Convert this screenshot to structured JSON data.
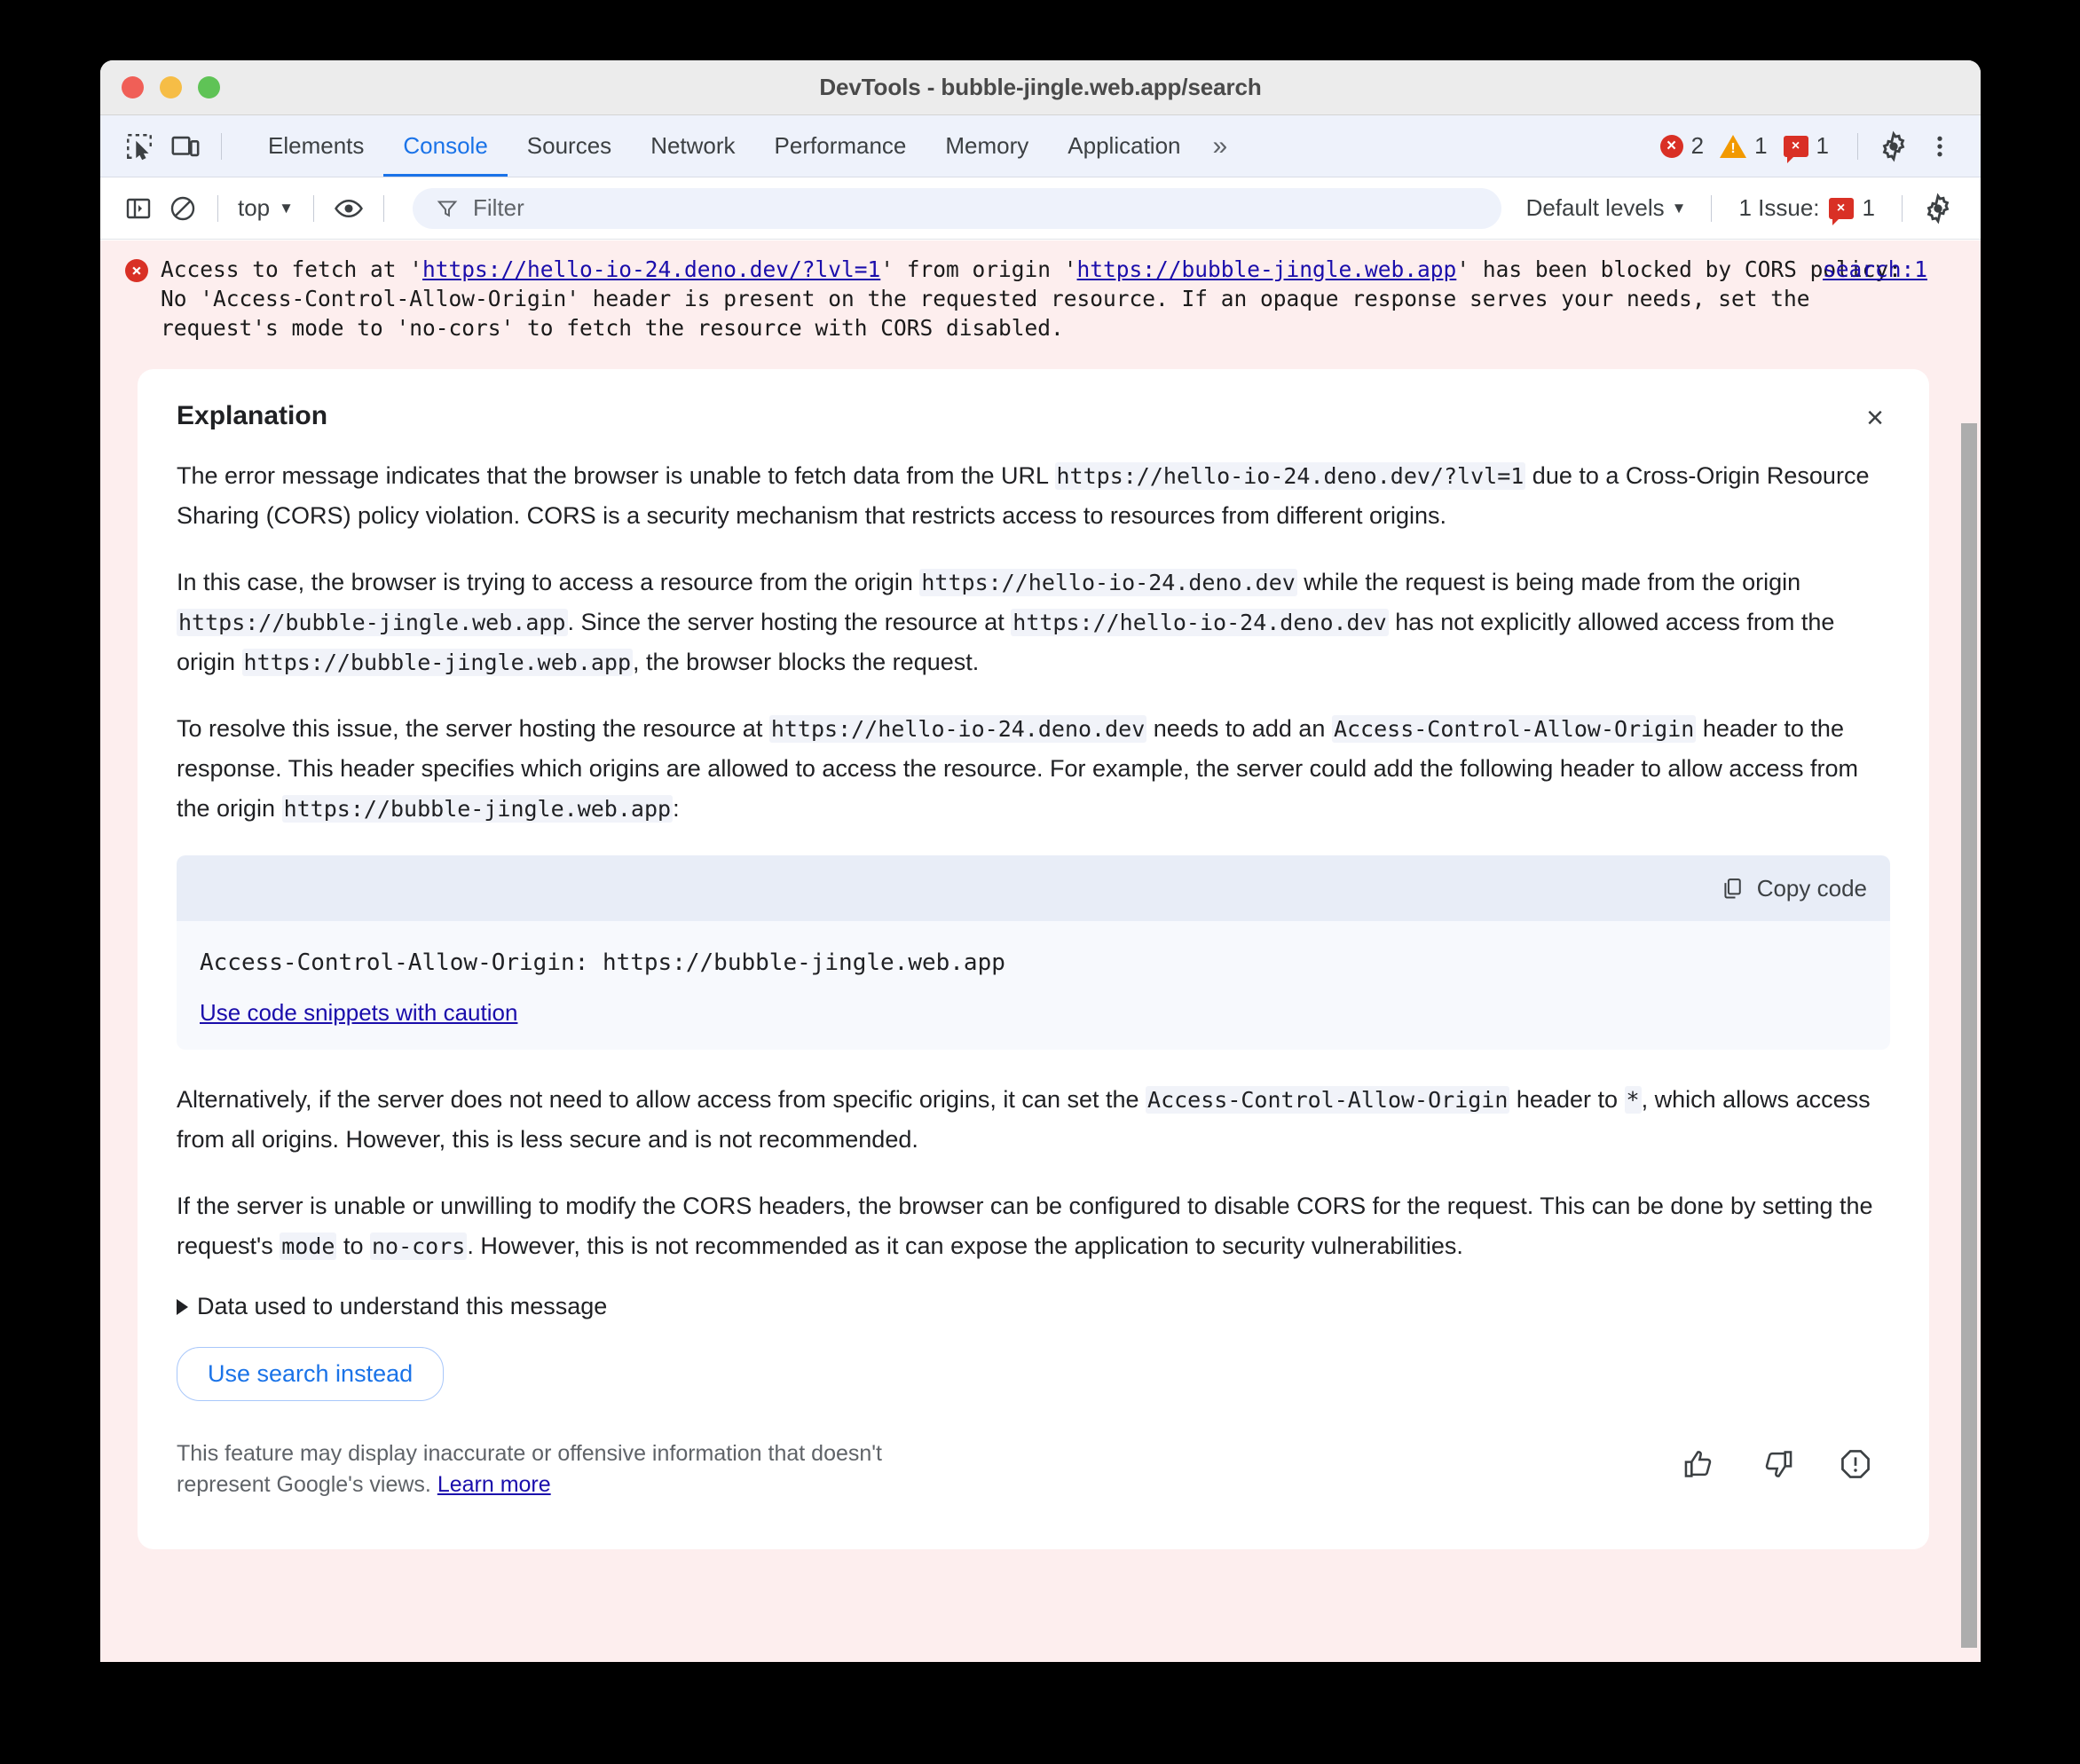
{
  "window": {
    "title": "DevTools - bubble-jingle.web.app/search",
    "traffic_lights": [
      "close",
      "minimize",
      "maximize"
    ]
  },
  "tabstrip": {
    "inspect_icon": "inspect-element-icon",
    "device_icon": "device-toolbar-icon",
    "tabs": [
      {
        "label": "Elements",
        "active": false
      },
      {
        "label": "Console",
        "active": true
      },
      {
        "label": "Sources",
        "active": false
      },
      {
        "label": "Network",
        "active": false
      },
      {
        "label": "Performance",
        "active": false
      },
      {
        "label": "Memory",
        "active": false
      },
      {
        "label": "Application",
        "active": false
      }
    ],
    "more_tabs_label": "»",
    "counts": {
      "errors": "2",
      "warnings": "1",
      "issues": "1",
      "issue_badge_glyph": "×",
      "error_badge_glyph": "×"
    },
    "settings_icon": "gear-icon",
    "menu_icon": "kebab-menu-icon"
  },
  "filterbar": {
    "sidebar_icon": "show-console-sidebar-icon",
    "clear_icon": "clear-console-icon",
    "context_label": "top",
    "eye_icon": "live-expression-icon",
    "filter_icon": "filter-funnel-icon",
    "filter_value": "",
    "filter_placeholder": "Filter",
    "levels_label": "Default levels",
    "issues_label": "1 Issue:",
    "issues_count": "1",
    "issue_badge_glyph": "×",
    "settings_icon": "gear-icon"
  },
  "console_message": {
    "severity": "error",
    "badge_glyph": "×",
    "part1": "Access to fetch at '",
    "url1": "https://hello-io-24.deno.dev/?lvl=1",
    "part2": "' from origin '",
    "url2": "https://bubble-jingle.web.app",
    "part3": "' has been blocked by CORS policy: No 'Access-Control-Allow-Origin' header is present on the requested resource. If an opaque response serves your needs, set the request's mode to 'no-cors' to fetch the resource with CORS disabled.",
    "source_link": "search:1"
  },
  "explanation": {
    "heading": "Explanation",
    "close_label": "×",
    "paragraphs": [
      {
        "id": "p1",
        "runs": [
          {
            "t": "text",
            "v": "The error message indicates that the browser is unable to fetch data from the URL "
          },
          {
            "t": "code",
            "v": "https://hello-io-24.deno.dev/?lvl=1"
          },
          {
            "t": "text",
            "v": " due to a Cross-Origin Resource Sharing (CORS) policy violation. CORS is a security mechanism that restricts access to resources from different origins."
          }
        ]
      },
      {
        "id": "p2",
        "runs": [
          {
            "t": "text",
            "v": "In this case, the browser is trying to access a resource from the origin "
          },
          {
            "t": "code",
            "v": "https://hello-io-24.deno.dev"
          },
          {
            "t": "text",
            "v": " while the request is being made from the origin "
          },
          {
            "t": "code",
            "v": "https://bubble-jingle.web.app"
          },
          {
            "t": "text",
            "v": ". Since the server hosting the resource at "
          },
          {
            "t": "code",
            "v": "https://hello-io-24.deno.dev"
          },
          {
            "t": "text",
            "v": " has not explicitly allowed access from the origin "
          },
          {
            "t": "code",
            "v": "https://bubble-jingle.web.app"
          },
          {
            "t": "text",
            "v": ", the browser blocks the request."
          }
        ]
      },
      {
        "id": "p3",
        "runs": [
          {
            "t": "text",
            "v": "To resolve this issue, the server hosting the resource at "
          },
          {
            "t": "code",
            "v": "https://hello-io-24.deno.dev"
          },
          {
            "t": "text",
            "v": " needs to add an "
          },
          {
            "t": "code",
            "v": "Access-Control-Allow-Origin"
          },
          {
            "t": "text",
            "v": " header to the response. This header specifies which origins are allowed to access the resource. For example, the server could add the following header to allow access from the origin "
          },
          {
            "t": "code",
            "v": "https://bubble-jingle.web.app"
          },
          {
            "t": "text",
            "v": ":"
          }
        ]
      },
      {
        "id": "p4",
        "runs": [
          {
            "t": "text",
            "v": "Alternatively, if the server does not need to allow access from specific origins, it can set the "
          },
          {
            "t": "code",
            "v": "Access-Control-Allow-Origin"
          },
          {
            "t": "text",
            "v": " header to "
          },
          {
            "t": "code",
            "v": "*"
          },
          {
            "t": "text",
            "v": ", which allows access from all origins. However, this is less secure and is not recommended."
          }
        ]
      },
      {
        "id": "p5",
        "runs": [
          {
            "t": "text",
            "v": "If the server is unable or unwilling to modify the CORS headers, the browser can be configured to disable CORS for the request. This can be done by setting the request's "
          },
          {
            "t": "code",
            "v": "mode"
          },
          {
            "t": "text",
            "v": " to "
          },
          {
            "t": "code",
            "v": "no-cors"
          },
          {
            "t": "text",
            "v": ". However, this is not recommended as it can expose the application to security vulnerabilities."
          }
        ]
      }
    ],
    "code_block": {
      "copy_label": "Copy code",
      "copy_icon": "copy-icon",
      "code": "Access-Control-Allow-Origin: https://bubble-jingle.web.app",
      "caution_link": "Use code snippets with caution"
    },
    "disclosure_label": "Data used to understand this message",
    "disclosure_expanded": false,
    "action_button": "Use search instead",
    "disclaimer_text": "This feature may display inaccurate or offensive information that doesn't represent Google's views. ",
    "disclaimer_link": "Learn more",
    "feedback": {
      "thumb_up": "thumb-up-icon",
      "thumb_down": "thumb-down-icon",
      "report": "report-icon"
    }
  },
  "colors": {
    "accent": "#1a73e8",
    "link": "#1a0dab",
    "error": "#d93025",
    "warning": "#f29900",
    "console_error_bg": "#fdeeee",
    "toolbar_bg": "#eef2fb"
  }
}
